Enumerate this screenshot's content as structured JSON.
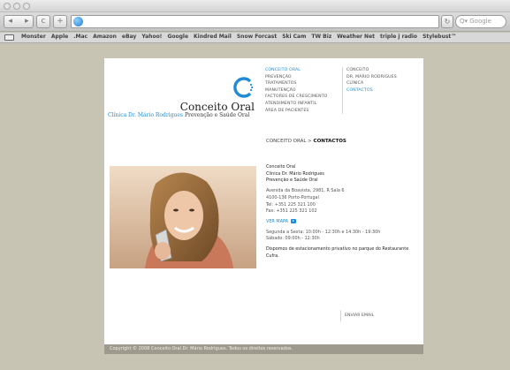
{
  "browser": {
    "back": "◂",
    "forward": "▸",
    "reload_glyph": "c",
    "add_glyph": "+",
    "address": "",
    "search_placeholder": "Q▾ Google",
    "bookmarks": [
      "Monster",
      "Apple",
      ".Mac",
      "Amazon",
      "eBay",
      "Yahoo!",
      "Google",
      "Kindred Mail",
      "Snow Forcast",
      "Ski Cam",
      "TW Biz",
      "Weather Net",
      "triple j radio",
      "Stylebust™"
    ]
  },
  "site": {
    "logo": {
      "name": "Conceito Oral",
      "clinic_prefix": "Clínica Dr. Mário Rodrigues",
      "clinic_suffix": "Prevenção e Saúde Oral"
    },
    "nav_primary": [
      {
        "label": "CONCEITO ORAL",
        "active": true
      },
      {
        "label": "PREVENÇÃO",
        "active": false
      },
      {
        "label": "TRATAMENTOS",
        "active": false
      },
      {
        "label": "MANUTENÇÃO",
        "active": false
      },
      {
        "label": "FACTORES DE CRESCIMENTO",
        "active": false
      },
      {
        "label": "ATENDIMENTO INFANTIL",
        "active": false
      },
      {
        "label": "ÁREA DE PACIENTES",
        "active": false
      }
    ],
    "nav_secondary": [
      {
        "label": "CONCEITO",
        "active": false
      },
      {
        "label": "DR. MÁRIO RODRIGUES",
        "active": false
      },
      {
        "label": "CLÍNICA",
        "active": false
      },
      {
        "label": "CONTACTOS",
        "active": true
      }
    ],
    "breadcrumb": {
      "parent": "CONCEITO ORAL",
      "separator": " > ",
      "current": "CONTACTOS"
    },
    "contact": {
      "title": "Conceito Oral",
      "doctor": "Clínica Dr. Mário Rodrigues",
      "tagline": "Prevenção e Saúde Oral",
      "address_1": "Avenida da Boavista, 2981, R Sala 6",
      "address_2": "4100-136 Porto-Portugal",
      "phone": "Tel: +351 225 321 100",
      "fax": "Fax: +351 225 321 102",
      "map_link": "VER MAPA",
      "hours_weekday": "Segunda a Sexta: 10:00h - 12:30h e 14:30h - 19:30h",
      "hours_saturday": "Sábado: 09:00h - 12:30h",
      "parking": "Dispomos de estacionamento privativo no parque do Restaurante Cufra."
    },
    "send_email": "ENVIAR EMAIL",
    "footer": "Copyright © 2008 Conceito Oral Dr. Mário Rodrigues. Todos os direitos reservados."
  },
  "colors": {
    "accent": "#1e8bd6",
    "background": "#c8c4b4",
    "footer": "#9e9a8d"
  }
}
